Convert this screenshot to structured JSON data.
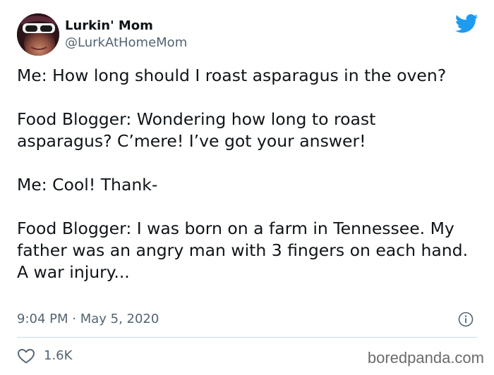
{
  "header": {
    "display_name": "Lurkin' Mom",
    "handle": "@LurkAtHomeMom"
  },
  "tweet": {
    "paragraphs": [
      "Me: How long should I roast asparagus in the oven?",
      "Food Blogger: Wondering how long to roast asparagus? C’mere! I’ve got your answer!",
      "Me: Cool! Thank-",
      "Food Blogger: I was born on a farm in Tennessee. My father was an angry man with 3 fingers on each hand. A war injury..."
    ],
    "timestamp": "9:04 PM · May 5, 2020"
  },
  "footer": {
    "likes": "1.6K",
    "watermark": "boredpanda.com"
  },
  "icons": {
    "brand": "twitter-bird-icon",
    "info": "info-icon",
    "like": "heart-icon"
  },
  "colors": {
    "twitter_blue": "#1d9bf0",
    "text": "#0f1419",
    "secondary": "#536471"
  }
}
